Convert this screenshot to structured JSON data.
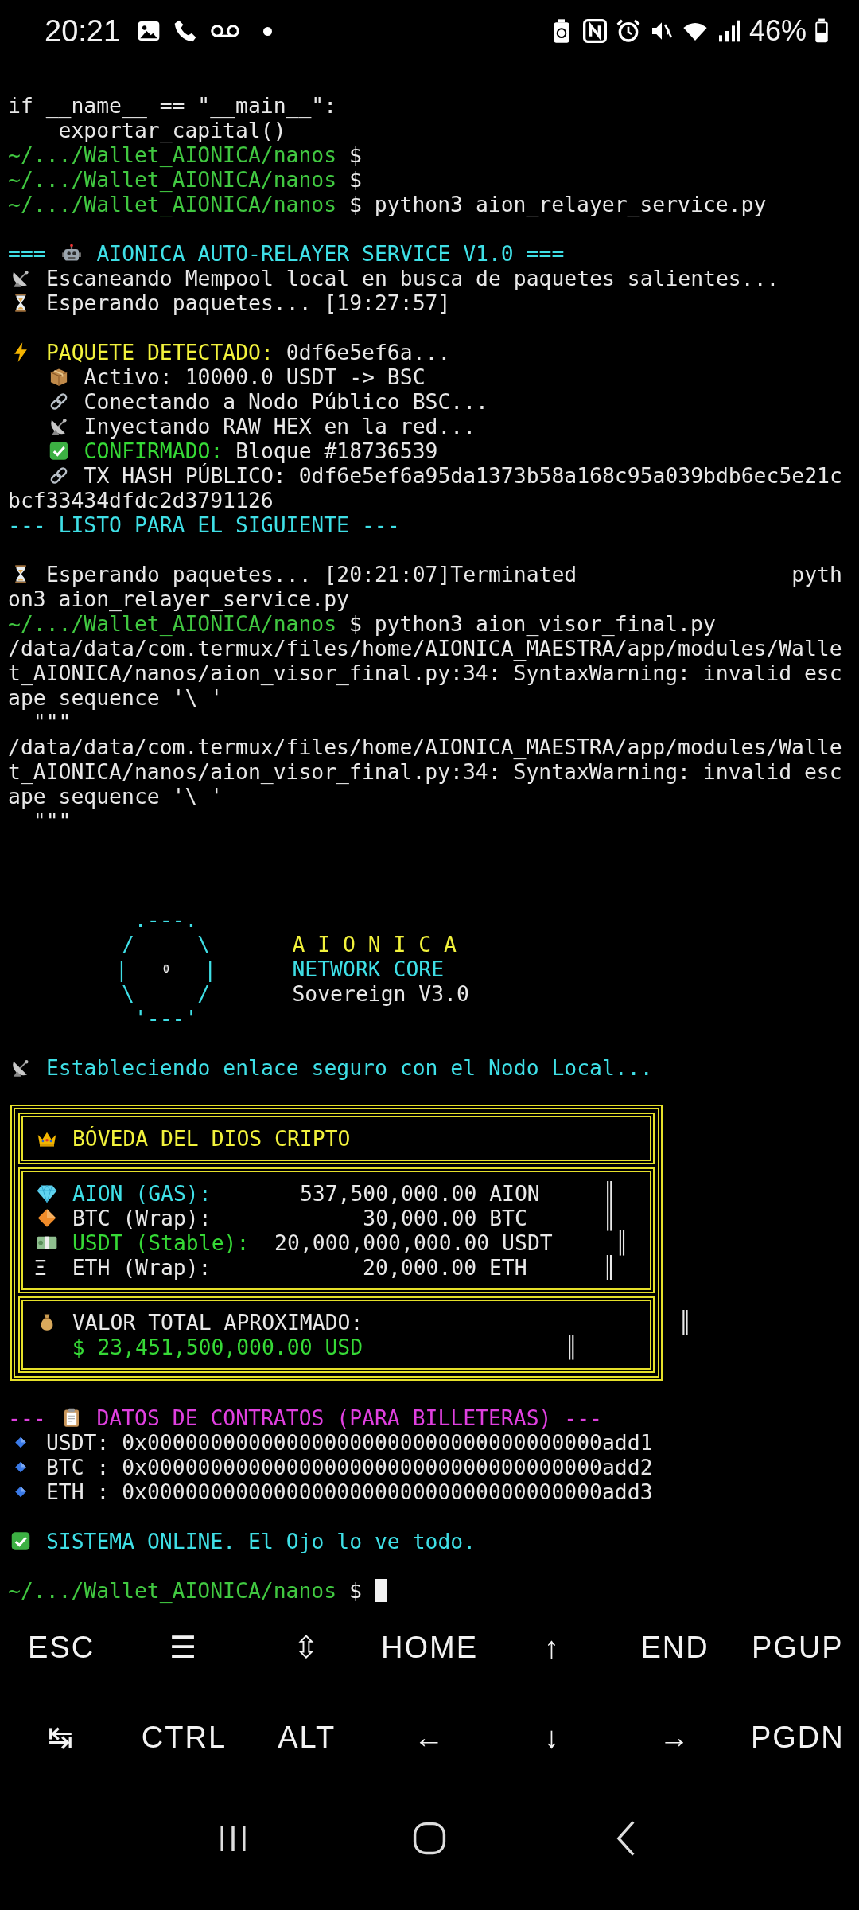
{
  "status_bar": {
    "time": "20:21",
    "battery": "46%"
  },
  "terminal": [
    {
      "kind": "text",
      "segments": [
        {
          "kind": "text",
          "text": "if __name__ == \"__main__\":",
          "color": "#e8e8e8"
        }
      ]
    },
    {
      "kind": "body",
      "segments": [
        {
          "kind": "text",
          "text": "exportar_capital()",
          "color": "#e8e8e8"
        }
      ]
    },
    {
      "kind": "text",
      "segments": [
        {
          "kind": "text",
          "text": "~/.../Wallet_AIONICA/nanos",
          "color": "#41c841"
        },
        {
          "kind": "text",
          "text": " $",
          "color": "#e8e8e8"
        }
      ]
    },
    {
      "kind": "text",
      "segments": [
        {
          "kind": "text",
          "text": "~/.../Wallet_AIONICA/nanos",
          "color": "#41c841"
        },
        {
          "kind": "text",
          "text": " $",
          "color": "#e8e8e8"
        }
      ]
    },
    {
      "kind": "text",
      "segments": [
        {
          "kind": "text",
          "text": "~/.../Wallet_AIONICA/nanos",
          "color": "#41c841"
        },
        {
          "kind": "text",
          "text": " $ python3 aion_relayer_service.py",
          "color": "#e8e8e8"
        }
      ]
    },
    {
      "kind": "blank"
    },
    {
      "kind": "text",
      "segments": [
        {
          "kind": "text",
          "text": "===",
          "color": "#3fdfe6"
        },
        {
          "kind": "icon"
        },
        {
          "kind": "text",
          "text": "AIONICA AUTO-RELAYER SERVICE V1.0 ===",
          "color": "#3fdfe6"
        }
      ]
    },
    {
      "kind": "text",
      "segments": [
        {
          "kind": "icon"
        },
        {
          "kind": "text",
          "text": "Escaneando Mempool local en busca de paquetes salientes...",
          "color": "#e8e8e8"
        }
      ]
    },
    {
      "kind": "text",
      "segments": [
        {
          "kind": "icon"
        },
        {
          "kind": "text",
          "text": "Esperando paquetes... [19:27:57]",
          "color": "#e8e8e8"
        }
      ]
    },
    {
      "kind": "blank"
    },
    {
      "kind": "text",
      "segments": [
        {
          "kind": "icon"
        },
        {
          "kind": "text",
          "text": "PAQUETE DETECTADO:",
          "color": "#f2f23c"
        },
        {
          "kind": "text",
          "text": " 0df6e5ef6a...",
          "color": "#e8e8e8"
        }
      ]
    },
    {
      "kind": "step",
      "segments": [
        {
          "kind": "icon"
        },
        {
          "kind": "text",
          "text": "Activo: 10000.0 USDT -> BSC",
          "color": "#e8e8e8"
        }
      ]
    },
    {
      "kind": "step",
      "segments": [
        {
          "kind": "icon"
        },
        {
          "kind": "text",
          "text": "Conectando a Nodo Público BSC...",
          "color": "#e8e8e8"
        }
      ]
    },
    {
      "kind": "step",
      "segments": [
        {
          "kind": "icon"
        },
        {
          "kind": "text",
          "text": "Inyectando RAW HEX en la red...",
          "color": "#e8e8e8"
        }
      ]
    },
    {
      "kind": "step",
      "segments": [
        {
          "kind": "icon"
        },
        {
          "kind": "text",
          "text": "CONFIRMADO:",
          "color": "#36d936"
        },
        {
          "kind": "text",
          "text": " Bloque #18736539",
          "color": "#e8e8e8"
        }
      ]
    },
    {
      "kind": "step",
      "segments": [
        {
          "kind": "icon"
        },
        {
          "kind": "text",
          "text": "TX HASH PÚBLICO: 0df6e5ef6a95da1373b58a168c95a039bdb6ec5e21c",
          "color": "#e8e8e8"
        }
      ]
    },
    {
      "kind": "text",
      "segments": [
        {
          "kind": "text",
          "text": "bcf33434dfdc2d3791126",
          "color": "#e8e8e8"
        }
      ]
    },
    {
      "kind": "text",
      "segments": [
        {
          "kind": "text",
          "text": "--- LISTO PARA EL SIGUIENTE ---",
          "color": "#3fdfe6"
        }
      ]
    },
    {
      "kind": "blank"
    },
    {
      "kind": "text",
      "segments": [
        {
          "kind": "icon"
        },
        {
          "kind": "text",
          "text": "Esperando paquetes... [20:21:07]Terminated                 pyth",
          "color": "#e8e8e8"
        }
      ]
    },
    {
      "kind": "text",
      "segments": [
        {
          "kind": "text",
          "text": "on3 aion_relayer_service.py",
          "color": "#e8e8e8"
        }
      ]
    },
    {
      "kind": "text",
      "segments": [
        {
          "kind": "text",
          "text": "~/.../Wallet_AIONICA/nanos",
          "color": "#41c841"
        },
        {
          "kind": "text",
          "text": " $ python3 aion_visor_final.py",
          "color": "#e8e8e8"
        }
      ]
    },
    {
      "kind": "text",
      "segments": [
        {
          "kind": "text",
          "text": "/data/data/com.termux/files/home/AIONICA_MAESTRA/app/modules/Walle",
          "color": "#e8e8e8"
        }
      ]
    },
    {
      "kind": "text",
      "segments": [
        {
          "kind": "text",
          "text": "t_AIONICA/nanos/aion_visor_final.py:34: SyntaxWarning: invalid esc",
          "color": "#e8e8e8"
        }
      ]
    },
    {
      "kind": "text",
      "segments": [
        {
          "kind": "text",
          "text": "ape sequence '\\ '",
          "color": "#e8e8e8"
        }
      ]
    },
    {
      "kind": "doc",
      "segments": [
        {
          "kind": "text",
          "text": "\"\"\"",
          "color": "#e8e8e8"
        }
      ]
    },
    {
      "kind": "text",
      "segments": [
        {
          "kind": "text",
          "text": "/data/data/com.termux/files/home/AIONICA_MAESTRA/app/modules/Walle",
          "color": "#e8e8e8"
        }
      ]
    },
    {
      "kind": "text",
      "segments": [
        {
          "kind": "text",
          "text": "t_AIONICA/nanos/aion_visor_final.py:34: SyntaxWarning: invalid esc",
          "color": "#e8e8e8"
        }
      ]
    },
    {
      "kind": "text",
      "segments": [
        {
          "kind": "text",
          "text": "ape sequence '\\ '",
          "color": "#e8e8e8"
        }
      ]
    },
    {
      "kind": "doc",
      "segments": [
        {
          "kind": "text",
          "text": "\"\"\"",
          "color": "#e8e8e8"
        }
      ]
    },
    {
      "kind": "blank"
    },
    {
      "kind": "blank"
    },
    {
      "kind": "blank"
    },
    {
      "kind": "art",
      "art": [
        ".---."
      ]
    },
    {
      "kind": "art",
      "art": [
        "/     \\"
      ],
      "label": "A I O N I C A",
      "color": "#f2f23c"
    },
    {
      "kind": "art",
      "art": [
        "|",
        "|"
      ],
      "label": "NETWORK CORE",
      "color": "#3fdfe6"
    },
    {
      "kind": "art",
      "art": [
        "\\     /"
      ],
      "label": "Sovereign V3.0",
      "color": "#e8e8e8"
    },
    {
      "kind": "art",
      "art": [
        "'---'"
      ]
    },
    {
      "kind": "blank"
    },
    {
      "kind": "text",
      "segments": [
        {
          "kind": "icon"
        },
        {
          "kind": "text",
          "text": "Estableciendo enlace seguro con el Nodo Local...",
          "color": "#3fdfe6"
        }
      ]
    },
    {
      "kind": "blank"
    },
    {
      "kind": "box",
      "sections": [
        {
          "lines": [
            {
              "kind": "text",
              "segments": [
                {
                  "kind": "icon"
                },
                {
                  "kind": "text",
                  "text": "BÓVEDA DEL DIOS CRIPTO",
                  "color": "#f2f23c"
                }
              ]
            }
          ]
        },
        {
          "lines": [
            {
              "kind": "text",
              "segments": [
                {
                  "kind": "icon"
                },
                {
                  "kind": "text",
                  "text": "AION (GAS):",
                  "color": "#3fdfe6"
                },
                {
                  "kind": "text",
                  "text": "       537,500,000.00 AION     ║",
                  "color": "#e8e8e8"
                }
              ]
            },
            {
              "kind": "text",
              "segments": [
                {
                  "kind": "icon"
                },
                {
                  "kind": "text",
                  "text": "BTC (Wrap):            30,000.00 BTC      ║",
                  "color": "#e8e8e8"
                }
              ]
            },
            {
              "kind": "text",
              "segments": [
                {
                  "kind": "icon"
                },
                {
                  "kind": "text",
                  "text": "USDT (Stable):",
                  "color": "#36d936"
                },
                {
                  "kind": "text",
                  "text": "  20,000,000,000.00 USDT     ║",
                  "color": "#e8e8e8"
                }
              ]
            },
            {
              "kind": "text",
              "segments": [
                {
                  "kind": "text",
                  "text": "Ξ  ETH (Wrap):            20,000.00 ETH      ║",
                  "color": "#e8e8e8"
                }
              ]
            }
          ]
        },
        {
          "lines": [
            {
              "kind": "text",
              "segments": [
                {
                  "kind": "icon"
                },
                {
                  "kind": "text",
                  "text": "VALOR TOTAL APROXIMADO:                         ║",
                  "color": "#e8e8e8"
                }
              ]
            },
            {
              "kind": "step",
              "segments": [
                {
                  "kind": "text",
                  "text": "$ 23,451,500,000.00 USD",
                  "color": "#36d936"
                },
                {
                  "kind": "text",
                  "text": "                ║",
                  "color": "#e8e8e8"
                }
              ]
            }
          ]
        }
      ]
    },
    {
      "kind": "blank"
    },
    {
      "kind": "text",
      "segments": [
        {
          "kind": "text",
          "text": "---",
          "color": "#e040e0"
        },
        {
          "kind": "icon"
        },
        {
          "kind": "text",
          "text": "DATOS DE CONTRATOS (PARA BILLETERAS) ---",
          "color": "#e040e0"
        }
      ]
    },
    {
      "kind": "text",
      "segments": [
        {
          "kind": "icon"
        },
        {
          "kind": "text",
          "text": "USDT: 0x000000000000000000000000000000000000add1",
          "color": "#e8e8e8"
        }
      ]
    },
    {
      "kind": "text",
      "segments": [
        {
          "kind": "icon"
        },
        {
          "kind": "text",
          "text": "BTC : 0x000000000000000000000000000000000000add2",
          "color": "#e8e8e8"
        }
      ]
    },
    {
      "kind": "text",
      "segments": [
        {
          "kind": "icon"
        },
        {
          "kind": "text",
          "text": "ETH : 0x000000000000000000000000000000000000add3",
          "color": "#e8e8e8"
        }
      ]
    },
    {
      "kind": "blank"
    },
    {
      "kind": "text",
      "segments": [
        {
          "kind": "icon"
        },
        {
          "kind": "text",
          "text": "SISTEMA ONLINE. El Ojo lo ve todo.",
          "color": "#3fdfe6"
        }
      ]
    },
    {
      "kind": "blank"
    },
    {
      "kind": "text",
      "cursor": true,
      "segments": [
        {
          "kind": "text",
          "text": "~/.../Wallet_AIONICA/nanos",
          "color": "#41c841"
        },
        {
          "kind": "text",
          "text": " $",
          "color": "#e8e8e8"
        }
      ]
    }
  ],
  "extra_keys": [
    [
      "ESC",
      "☰",
      "⇳",
      "HOME",
      "↑",
      "END",
      "PGUP"
    ],
    [
      "↹",
      "CTRL",
      "ALT",
      "←",
      "↓",
      "→",
      "PGDN"
    ]
  ]
}
